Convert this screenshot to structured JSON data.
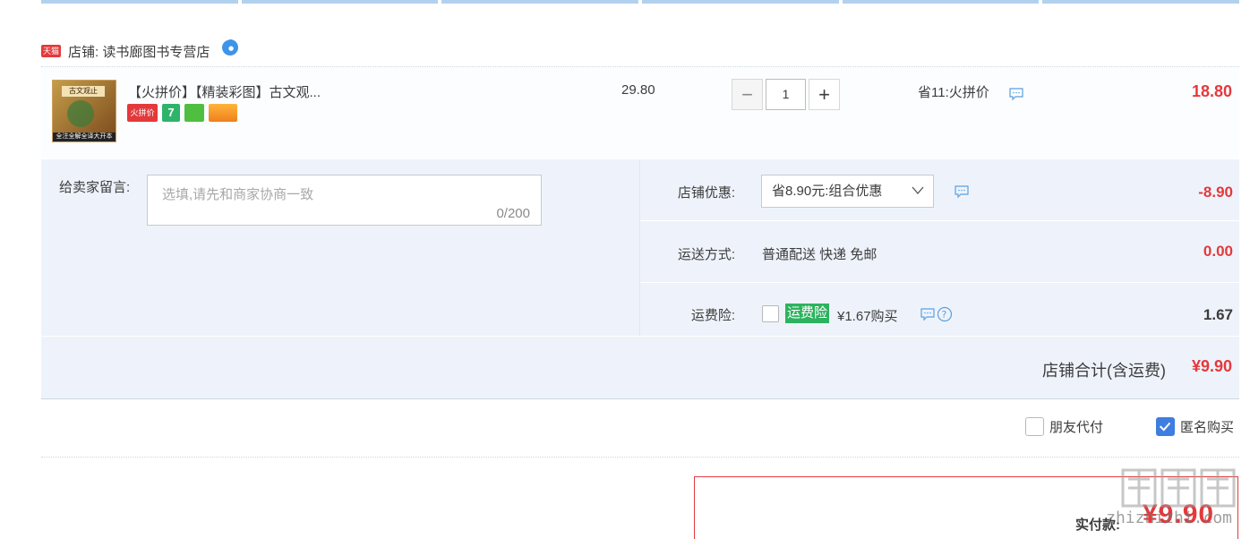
{
  "shop": {
    "badge": "天猫",
    "name": "店铺: 读书廊图书专营店"
  },
  "item": {
    "thumb_top_text": "古文观止",
    "thumb_bottom_text": "全注全解全译大开本",
    "title": "【火拼价】【精装彩图】古文观...",
    "tag_red": "火拼价",
    "tag_seven": "7",
    "unit_price": "29.80",
    "quantity": "1",
    "minus": "−",
    "plus": "+",
    "promo": "省11:火拼价",
    "total": "18.80"
  },
  "message": {
    "label": "给卖家留言:",
    "placeholder": "选填,请先和商家协商一致",
    "count": "0/200"
  },
  "discount": {
    "label": "店铺优惠:",
    "selected": "省8.90元:组合优惠",
    "amount": "-8.90"
  },
  "shipping": {
    "label": "运送方式:",
    "value": "普通配送 快递 免邮",
    "amount": "0.00"
  },
  "insurance": {
    "label": "运费险:",
    "badge": "运费险",
    "value": "¥1.67购买",
    "amount": "1.67"
  },
  "subtotal": {
    "label": "店铺合计(含运费)",
    "value": "¥9.90"
  },
  "options": {
    "friend_pay": "朋友代付",
    "anonymous": "匿名购买",
    "anonymous_checked": true
  },
  "payment": {
    "label": "实付款:",
    "value": "¥9.90"
  },
  "watermark": {
    "text": "zhizhizhi.com"
  },
  "colors": {
    "accent_red": "#e4393c",
    "panel_blue": "#eef3fb",
    "check_blue": "#3d7ee0",
    "insurance_green": "#2db25f"
  }
}
